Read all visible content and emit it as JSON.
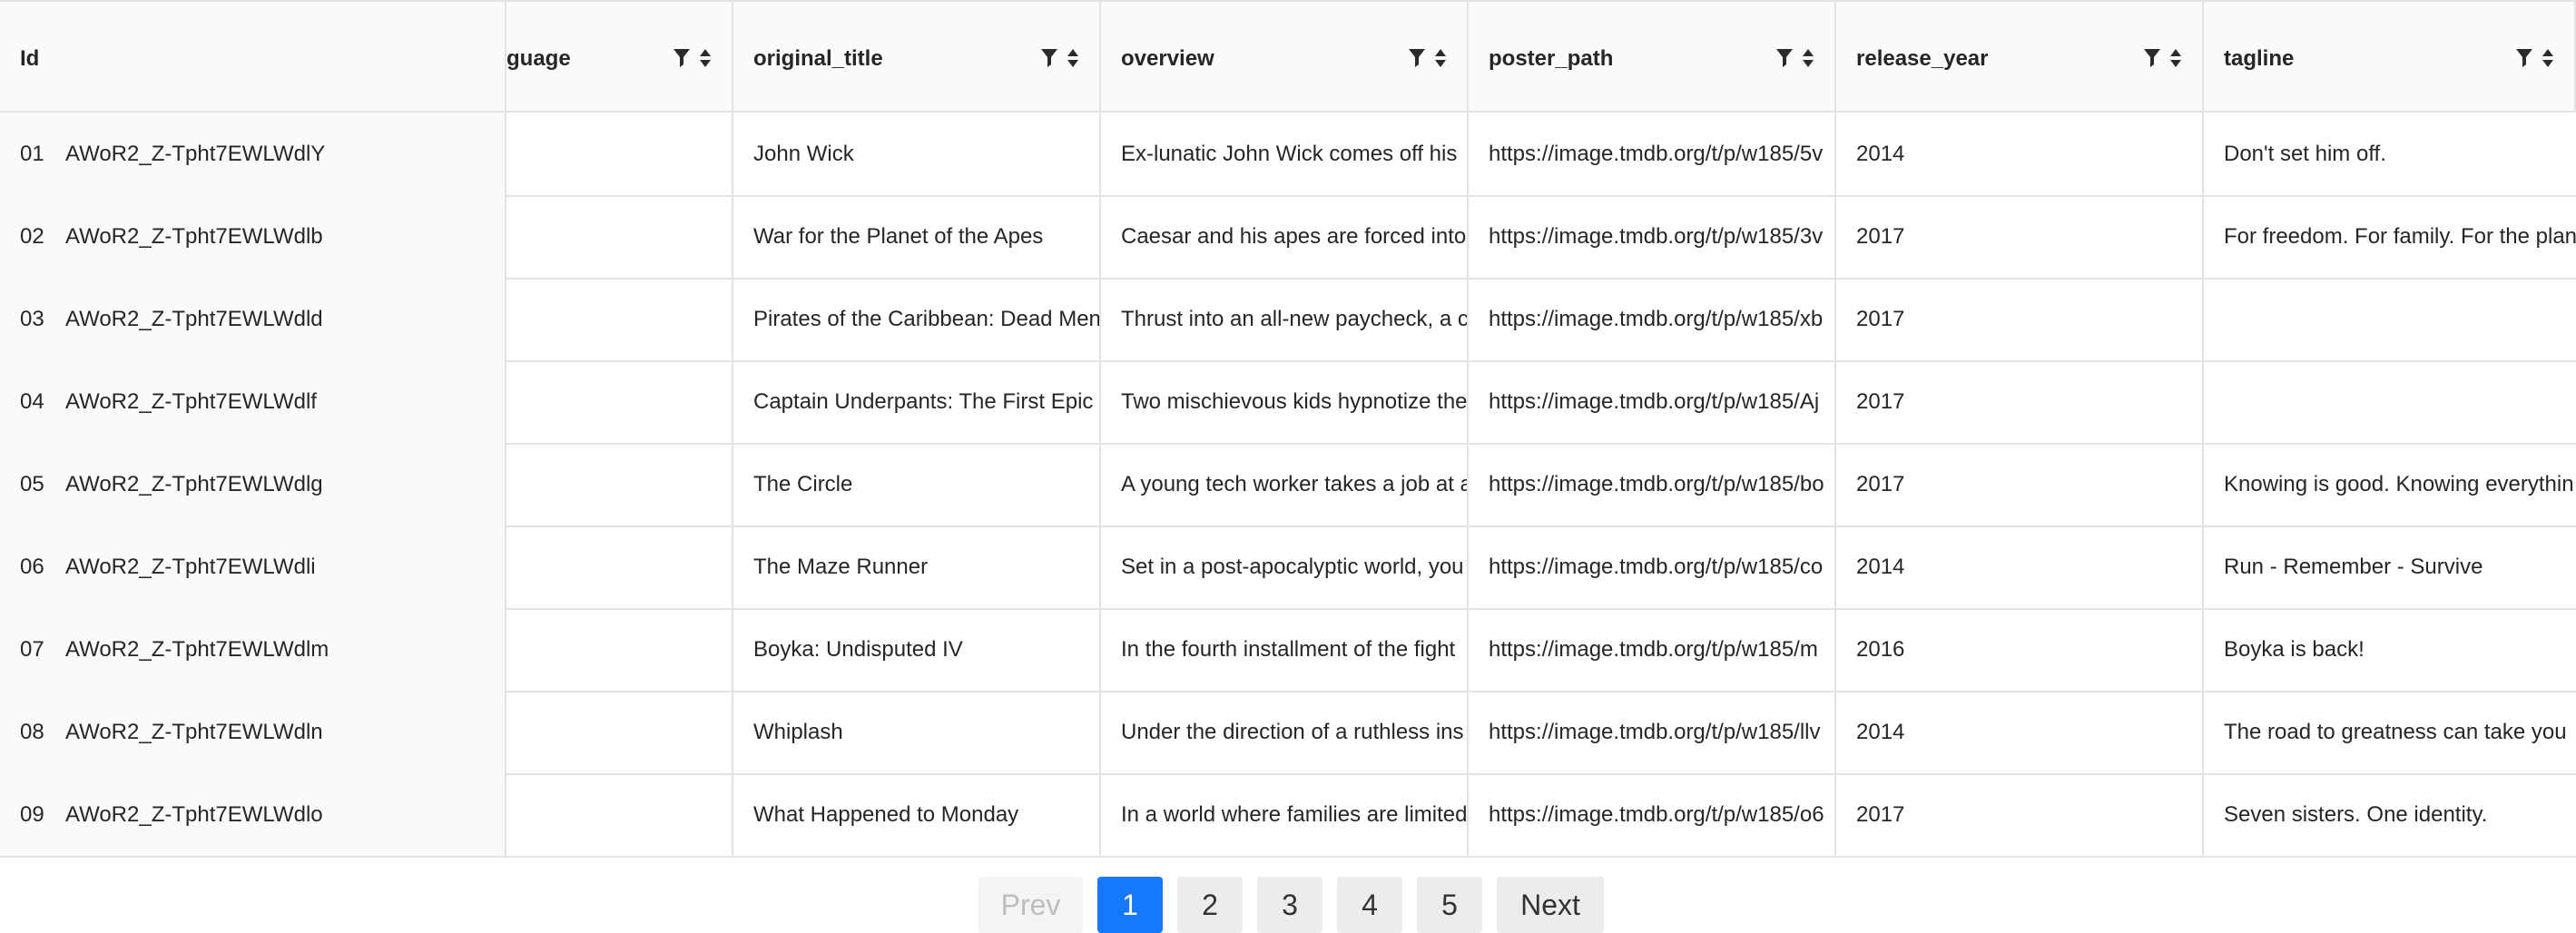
{
  "columns": {
    "id": "Id",
    "language": "guage",
    "original_title": "original_title",
    "overview": "overview",
    "poster_path": "poster_path",
    "release_year": "release_year",
    "tagline": "tagline"
  },
  "icons": {
    "filter": "filter-icon",
    "sort": "sort-icon"
  },
  "rows": [
    {
      "num": "01",
      "id": "AWoR2_Z-Tpht7EWLWdlY",
      "language": "",
      "title": "John Wick",
      "overview": "Ex-lunatic John Wick comes off his",
      "poster": "https://image.tmdb.org/t/p/w185/5v",
      "year": "2014",
      "tagline": "Don't set him off."
    },
    {
      "num": "02",
      "id": "AWoR2_Z-Tpht7EWLWdlb",
      "language": "",
      "title": "War for the Planet of the Apes",
      "overview": "Caesar and his apes are forced into",
      "poster": "https://image.tmdb.org/t/p/w185/3v",
      "year": "2017",
      "tagline": "For freedom. For family. For the plan"
    },
    {
      "num": "03",
      "id": "AWoR2_Z-Tpht7EWLWdld",
      "language": "",
      "title": "Pirates of the Caribbean: Dead Men",
      "overview": "Thrust into an all-new paycheck, a c",
      "poster": "https://image.tmdb.org/t/p/w185/xb",
      "year": "2017",
      "tagline": ""
    },
    {
      "num": "04",
      "id": "AWoR2_Z-Tpht7EWLWdlf",
      "language": "",
      "title": "Captain Underpants: The First Epic",
      "overview": "Two mischievous kids hypnotize the",
      "poster": "https://image.tmdb.org/t/p/w185/Aj",
      "year": "2017",
      "tagline": ""
    },
    {
      "num": "05",
      "id": "AWoR2_Z-Tpht7EWLWdlg",
      "language": "",
      "title": "The Circle",
      "overview": "A young tech worker takes a job at a",
      "poster": "https://image.tmdb.org/t/p/w185/bo",
      "year": "2017",
      "tagline": "Knowing is good. Knowing everythin"
    },
    {
      "num": "06",
      "id": "AWoR2_Z-Tpht7EWLWdli",
      "language": "",
      "title": "The Maze Runner",
      "overview": "Set in a post-apocalyptic world, you",
      "poster": "https://image.tmdb.org/t/p/w185/co",
      "year": "2014",
      "tagline": "Run - Remember - Survive"
    },
    {
      "num": "07",
      "id": "AWoR2_Z-Tpht7EWLWdlm",
      "language": "",
      "title": "Boyka: Undisputed IV",
      "overview": "In the fourth installment of the fight",
      "poster": "https://image.tmdb.org/t/p/w185/m",
      "year": "2016",
      "tagline": "Boyka is back!"
    },
    {
      "num": "08",
      "id": "AWoR2_Z-Tpht7EWLWdln",
      "language": "",
      "title": "Whiplash",
      "overview": "Under the direction of a ruthless ins",
      "poster": "https://image.tmdb.org/t/p/w185/llv",
      "year": "2014",
      "tagline": "The road to greatness can take you"
    },
    {
      "num": "09",
      "id": "AWoR2_Z-Tpht7EWLWdlo",
      "language": "",
      "title": "What Happened to Monday",
      "overview": "In a world where families are limited",
      "poster": "https://image.tmdb.org/t/p/w185/o6",
      "year": "2017",
      "tagline": "Seven sisters. One identity."
    }
  ],
  "pagination": {
    "prev": "Prev",
    "pages": [
      "1",
      "2",
      "3",
      "4",
      "5"
    ],
    "current_page": "1",
    "next": "Next"
  },
  "colors": {
    "accent": "#1677ff",
    "header_bg": "#fafafa",
    "border": "#e3e3e3"
  }
}
